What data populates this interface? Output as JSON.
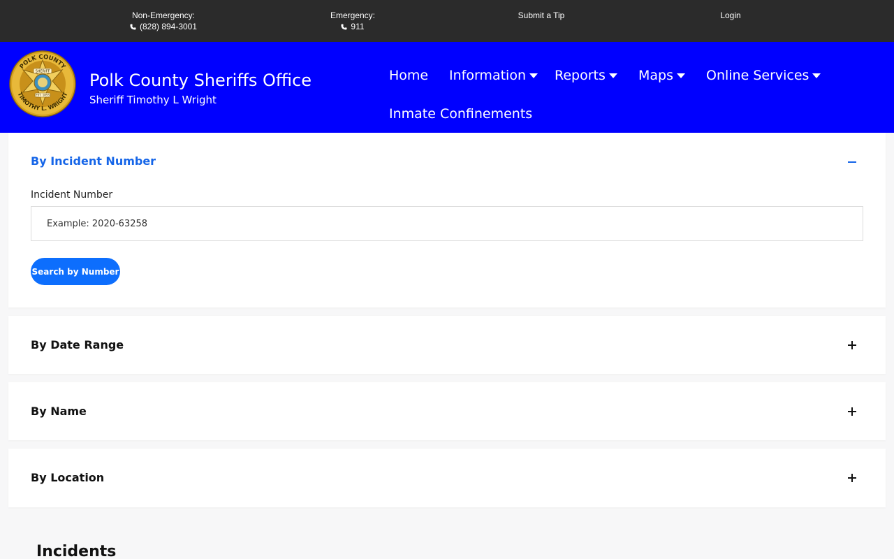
{
  "topbar": {
    "non_emergency_label": "Non-Emergency:",
    "non_emergency_phone": "(828) 894-3001",
    "emergency_label": "Emergency:",
    "emergency_phone": "911",
    "submit_tip": "Submit a Tip",
    "login": "Login"
  },
  "header": {
    "title": "Polk County Sheriffs Office",
    "subtitle": "Sheriff Timothy L Wright",
    "badge_text_top": "POLK COUNTY",
    "badge_text_bottom": "TIMOTHY L. WRIGHT",
    "badge_center": "SHERIFF",
    "badge_est": "EST. 1855",
    "nav": {
      "home": "Home",
      "information": "Information",
      "reports": "Reports",
      "maps": "Maps",
      "online_services": "Online Services",
      "inmate": "Inmate Confinements"
    }
  },
  "search": {
    "by_number": {
      "title": "By Incident Number",
      "field_label": "Incident Number",
      "placeholder": "Example: 2020-63258",
      "button": "Search by Number"
    },
    "by_date": {
      "title": "By Date Range"
    },
    "by_name": {
      "title": "By Name"
    },
    "by_location": {
      "title": "By Location"
    }
  },
  "incidents": {
    "heading": "Incidents"
  },
  "colors": {
    "topbar_bg": "#2b2b2b",
    "header_bg": "#0000ff",
    "accent": "#1565e8",
    "button": "#0d6efd"
  },
  "icons": {
    "phone": "phone-icon",
    "collapse": "minus-icon",
    "expand": "plus-icon",
    "dropdown": "caret-down-icon"
  }
}
